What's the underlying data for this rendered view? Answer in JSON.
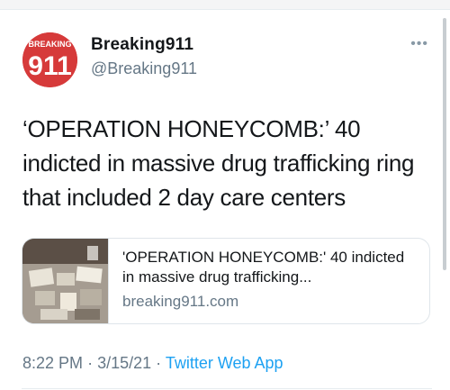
{
  "tweet": {
    "author_name": "Breaking911",
    "author_handle": "@Breaking911",
    "avatar_logo_text_top": "BREAKING",
    "avatar_logo_text_main": "911",
    "more_icon": "more-icon",
    "text": "‘OPERATION HONEYCOMB:’ 40 indicted in massive drug trafficking ring that included 2 day care centers",
    "link_card": {
      "title": "'OPERATION HONEYCOMB:' 40 indicted in massive drug trafficking...",
      "domain": "breaking911.com"
    },
    "time": "8:22 PM",
    "date": "3/15/21",
    "separator": "·",
    "source_app": "Twitter Web App"
  },
  "colors": {
    "brand_red": "#d63a3a",
    "link_blue": "#1da1f2",
    "secondary_text": "#657786"
  }
}
